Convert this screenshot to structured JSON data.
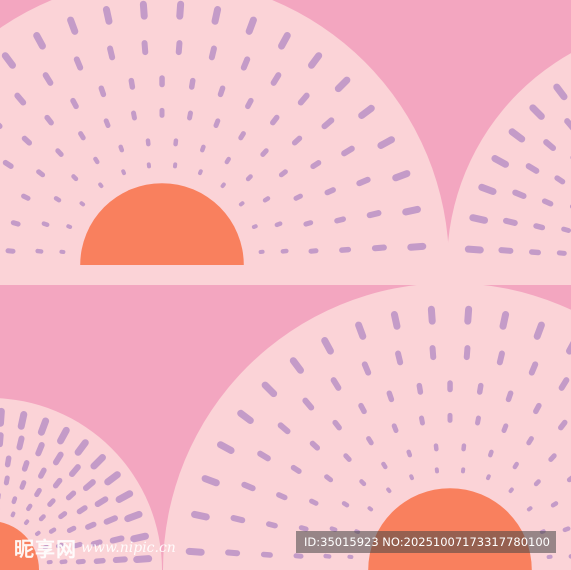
{
  "image": {
    "description_free": true,
    "colors": {
      "background": "#f3a6c0",
      "fan": "#fbd3d7",
      "band": "#fbd3d7",
      "dash": "#c49bc8",
      "sun": "#f9805e"
    }
  },
  "watermark": {
    "brand": "昵享网",
    "site": "www.nipic.cn",
    "id_text": "ID:35015923 NO:20251007173317780100"
  }
}
